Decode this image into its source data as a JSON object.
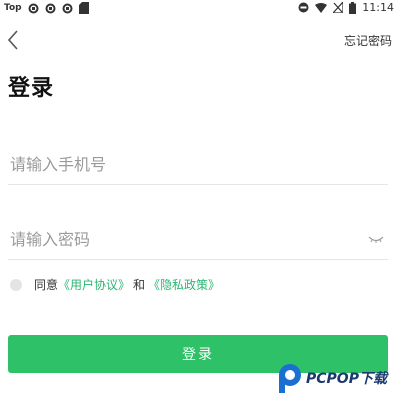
{
  "status_bar": {
    "carrier": "Top",
    "time": "11:14"
  },
  "nav": {
    "forgot_password": "忘记密码"
  },
  "page": {
    "title": "登录"
  },
  "form": {
    "phone_placeholder": "请输入手机号",
    "password_placeholder": "请输入密码"
  },
  "agreement": {
    "prefix": "同意",
    "user_agreement": "《用户协议》",
    "conjunction": "和",
    "privacy_policy": "《隐私政策》"
  },
  "login_button": {
    "label": "登录"
  },
  "watermark": {
    "text": "PCPOP下载"
  },
  "colors": {
    "accent": "#2ec168",
    "link": "#2bb673"
  }
}
